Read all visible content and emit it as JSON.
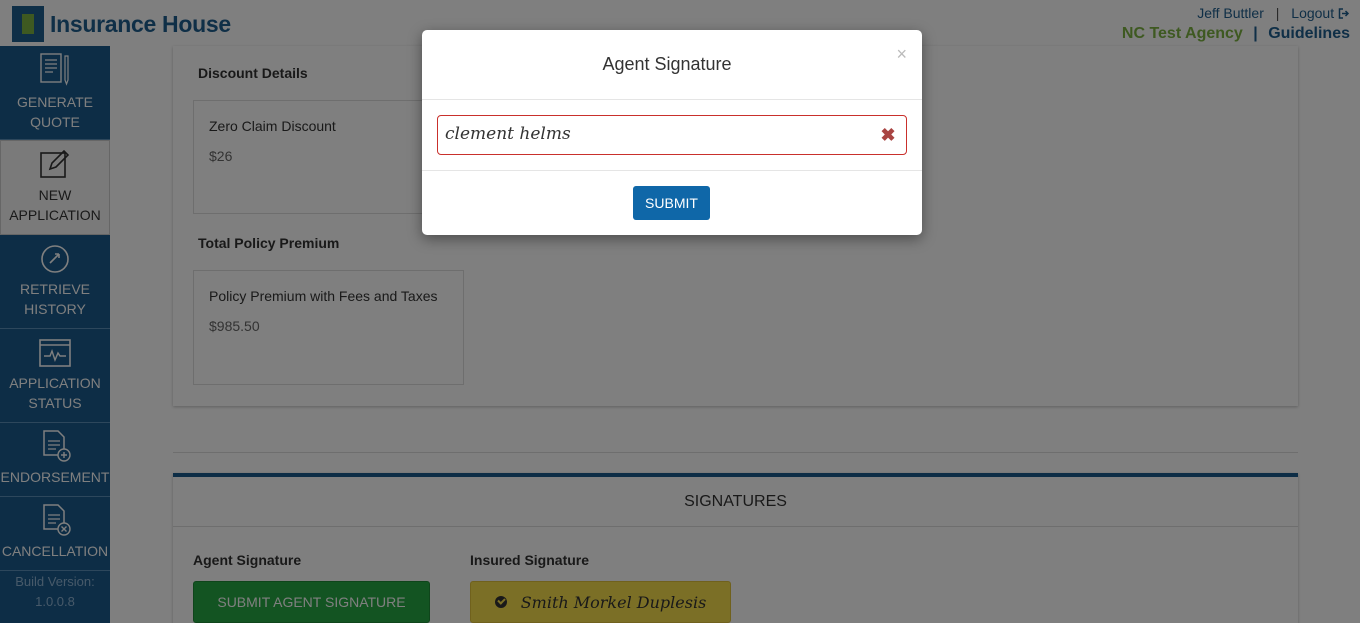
{
  "header": {
    "logo_text": "Insurance House",
    "user_name": "Jeff Buttler",
    "separator": "|",
    "logout_label": "Logout",
    "agency_name": "NC Test Agency",
    "guidelines_label": "Guidelines"
  },
  "sidebar": {
    "items": [
      {
        "label": "GENERATE QUOTE",
        "icon": "generate-quote-icon"
      },
      {
        "label": "NEW APPLICATION",
        "icon": "new-application-icon"
      },
      {
        "label": "RETRIEVE HISTORY",
        "icon": "history-icon"
      },
      {
        "label": "APPLICATION STATUS",
        "icon": "status-icon"
      },
      {
        "label": "ENDORSEMENT",
        "icon": "endorsement-icon"
      },
      {
        "label": "CANCELLATION",
        "icon": "cancellation-icon"
      }
    ],
    "build_label": "Build Version:",
    "build_version": "1.0.0.8"
  },
  "discount": {
    "title": "Discount Details",
    "card_label": "Zero Claim Discount",
    "card_value": "$26"
  },
  "premium": {
    "title": "Total Policy Premium",
    "card_label": "Policy Premium with Fees and Taxes",
    "card_value": "$985.50"
  },
  "signatures": {
    "heading": "SIGNATURES",
    "agent_label": "Agent Signature",
    "agent_button": "SUBMIT AGENT SIGNATURE",
    "insured_label": "Insured Signature",
    "insured_signature": "Smith Morkel Duplesis"
  },
  "modal": {
    "title": "Agent Signature",
    "close_glyph": "×",
    "signature_value": "clement helms",
    "clear_glyph": "✖",
    "submit_label": "SUBMIT"
  },
  "colors": {
    "brand_blue": "#1a5b8d",
    "brand_green": "#7cb342",
    "submit_blue": "#0f67a8",
    "agent_button_green": "#27a844",
    "insured_button_yellow": "#f7df4d",
    "error_red": "#c9302c"
  }
}
